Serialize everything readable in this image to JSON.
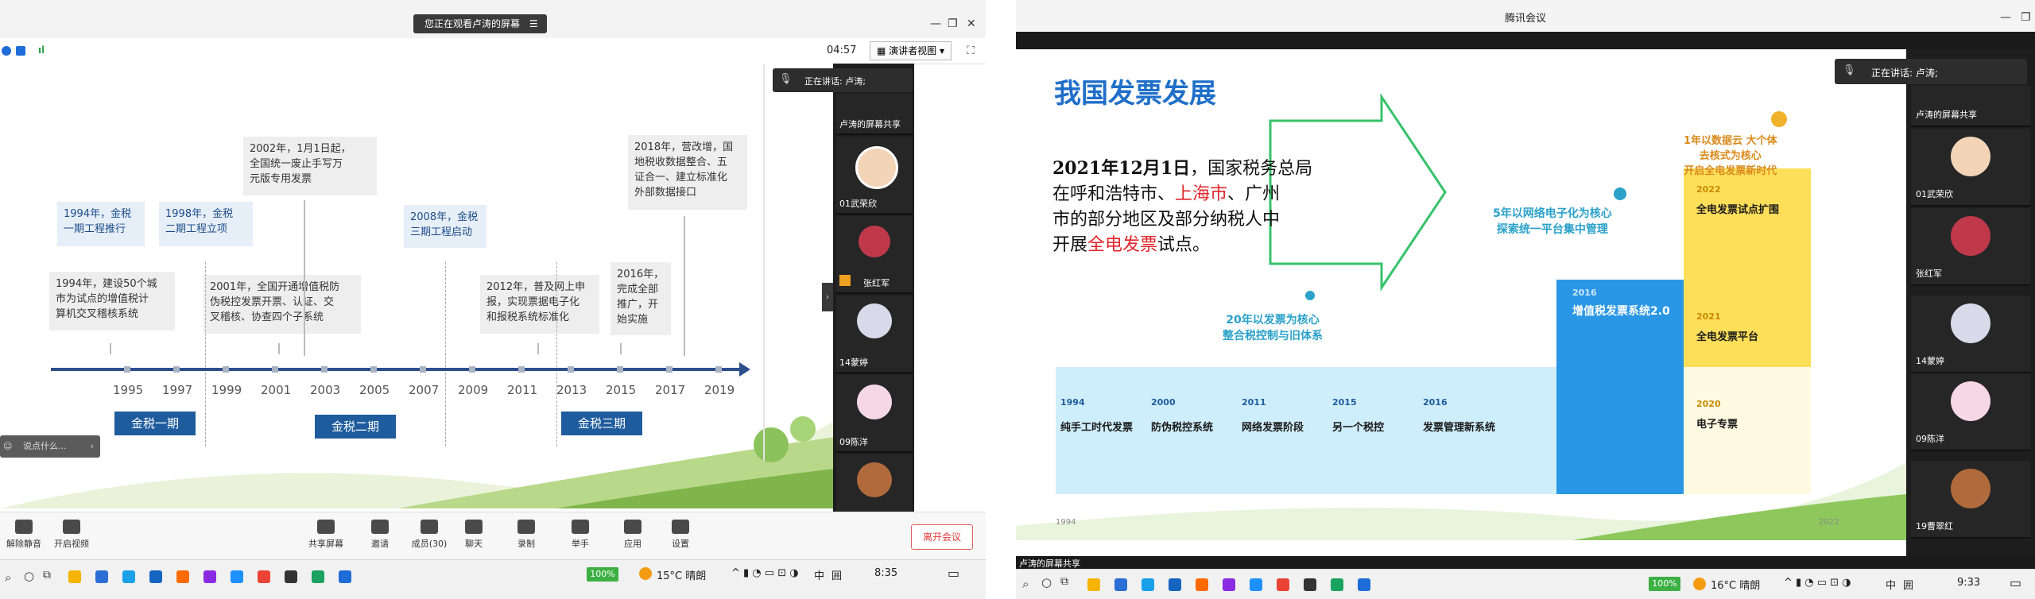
{
  "left": {
    "banner": "您正在观看卢涛的屏幕",
    "timer": "04:57",
    "view_label": "演讲者视图",
    "speaking": "正在讲话: 卢涛;",
    "events_top": [
      {
        "text": "1994年，金税\n一期工程推行"
      },
      {
        "text": "1998年，金税\n二期工程立项"
      },
      {
        "text": "2002年，1月1日起，\n全国统一废止手写万\n元版专用发票"
      },
      {
        "text": "2008年，金税\n三期工程启动"
      },
      {
        "text": "2018年，营改增，国\n地税收数据整合、五\n证合一、建立标准化\n外部数据接口"
      }
    ],
    "events_bottom": [
      {
        "text": "1994年，建设50个城\n市为试点的增值税计\n算机交叉稽核系统"
      },
      {
        "text": "2001年，全国开通增值税防\n伪税控发票开票、认证、交\n叉稽核、协查四个子系统"
      },
      {
        "text": "2012年，普及网上申\n报，实现票据电子化\n和报税系统标准化"
      },
      {
        "text": "2016年，\n完成全部\n推广，开\n始实施"
      }
    ],
    "years": [
      "1995",
      "1997",
      "1999",
      "2001",
      "2003",
      "2005",
      "2007",
      "2009",
      "2011",
      "2013",
      "2015",
      "2017",
      "2019"
    ],
    "phases": [
      "金税一期",
      "金税二期",
      "金税三期"
    ],
    "chat_placeholder": "说点什么...",
    "participants": [
      {
        "name": "卢涛的屏幕共享"
      },
      {
        "name": "01武荣欣"
      },
      {
        "name": "张红军"
      },
      {
        "name": "14蒙婷"
      },
      {
        "name": "09陈洋"
      }
    ],
    "controls": [
      "解除静音",
      "开启视频",
      "共享屏幕",
      "邀请",
      "成员(30)",
      "聊天",
      "录制",
      "举手",
      "应用",
      "设置"
    ],
    "leave": "离开会议",
    "taskbar": {
      "battery": "100%",
      "weather": "15°C 晴朗",
      "ime": "中",
      "time": "8:35"
    }
  },
  "right": {
    "window_title": "腾讯会议",
    "speaking": "正在讲话: 卢涛;",
    "title": "我国发票发展",
    "quote_parts": {
      "p1": "2021年12月1日",
      "p2": "，国家税务总局\n在呼和浩特市、",
      "p3": "上海市",
      "p4": "、广州\n市的部分地区及部分纳税人中\n开展",
      "p5": "全电发票",
      "p6": "试点。"
    },
    "notes": {
      "cyan_left": "20年以发票为核心\n整合税控制与旧体系",
      "cyan_mid": "5年以网络电子化为核心\n探索统一平台集中管理",
      "orange_top": "1年以数据云 大个体\n去核式为核心\n开启全电发票新时代"
    },
    "stages": [
      {
        "year": "1994",
        "title": "纯手工时代发票"
      },
      {
        "year": "2000",
        "title": "防伪税控系统"
      },
      {
        "year": "2011",
        "title": "网络发票阶段"
      },
      {
        "year": "2015",
        "title": "另一个税控"
      },
      {
        "year": "2016",
        "title": "发票管理新系统"
      }
    ],
    "blue_stage": {
      "year": "2016",
      "title": "增值税发票系统2.0"
    },
    "yellow_stages": [
      {
        "year": "2022",
        "title": "全电发票试点扩围"
      },
      {
        "year": "2021",
        "title": "全电发票平台"
      },
      {
        "year": "2020",
        "title": "电子专票"
      }
    ],
    "corner_years": [
      "1994",
      "2022"
    ],
    "participants": [
      {
        "name": "卢涛的屏幕共享"
      },
      {
        "name": "01武荣欣"
      },
      {
        "name": "张红军"
      },
      {
        "name": "14蒙婷"
      },
      {
        "name": "09陈洋"
      },
      {
        "name": "19曹翠红"
      }
    ],
    "share_label": "卢涛的屏幕共享",
    "taskbar": {
      "battery": "100%",
      "weather": "16°C 晴朗",
      "ime": "中",
      "time": "9:33"
    }
  }
}
